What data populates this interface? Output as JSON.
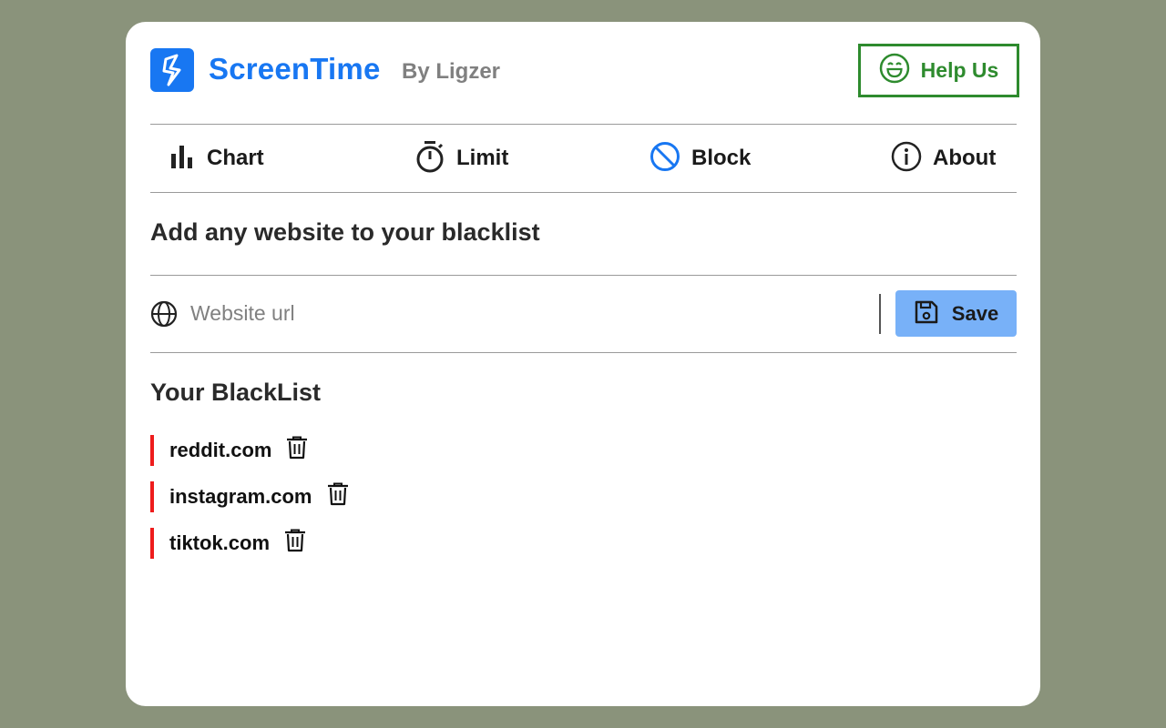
{
  "header": {
    "brand": "ScreenTime",
    "byline": "By Ligzer",
    "help_label": "Help Us",
    "brand_color": "#1877f2",
    "help_color": "#2e8b2e"
  },
  "tabs": [
    {
      "label": "Chart",
      "icon": "bar-chart-icon"
    },
    {
      "label": "Limit",
      "icon": "stopwatch-icon"
    },
    {
      "label": "Block",
      "icon": "block-icon",
      "active": true
    },
    {
      "label": "About",
      "icon": "info-icon"
    }
  ],
  "block": {
    "section_title": "Add any website to your blacklist",
    "url_placeholder": "Website url",
    "url_value": "",
    "save_label": "Save",
    "list_title": "Your BlackList",
    "items": [
      "reddit.com",
      "instagram.com",
      "tiktok.com"
    ],
    "item_marker_color": "#ee1c1c"
  }
}
